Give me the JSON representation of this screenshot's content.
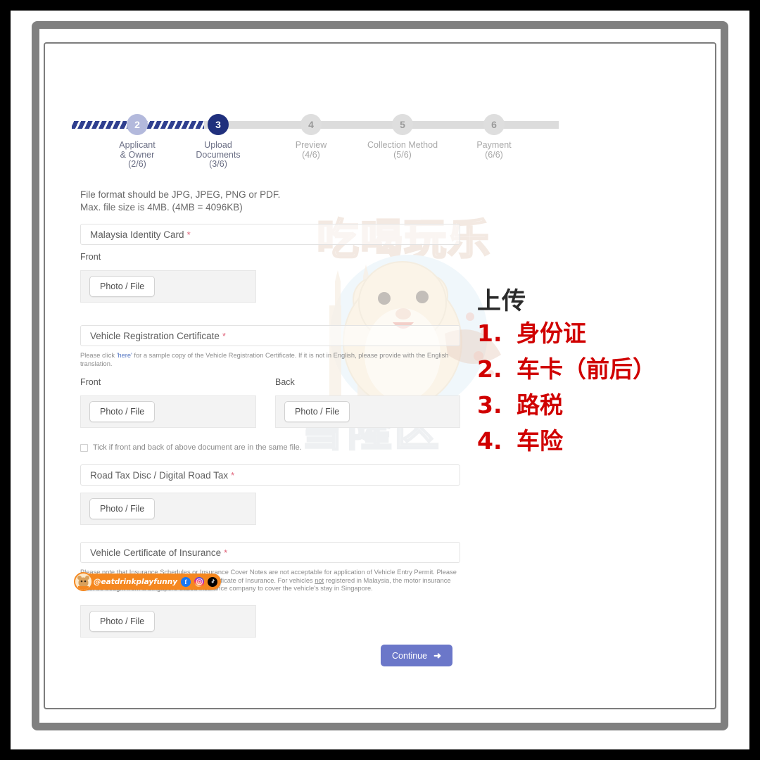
{
  "stepper": {
    "steps": [
      {
        "number": "2",
        "label_line1": "Applicant",
        "label_line2": "& Owner",
        "progress": "(2/6)",
        "state": "completed"
      },
      {
        "number": "3",
        "label_line1": "Upload",
        "label_line2": "Documents",
        "progress": "(3/6)",
        "state": "current"
      },
      {
        "number": "4",
        "label_line1": "Preview",
        "label_line2": "",
        "progress": "(4/6)",
        "state": "upcoming"
      },
      {
        "number": "5",
        "label_line1": "Collection Method",
        "label_line2": "",
        "progress": "(5/6)",
        "state": "upcoming"
      },
      {
        "number": "6",
        "label_line1": "Payment",
        "label_line2": "",
        "progress": "(6/6)",
        "state": "upcoming"
      }
    ],
    "colors": {
      "completed_bar": "#2f3f8f",
      "completed_dot": "#b3b9dc",
      "current_dot": "#20307d",
      "upcoming": "#dedede"
    }
  },
  "format_note": {
    "line1": "File format should be JPG, JPEG, PNG or PDF.",
    "line2": "Max. file size is 4MB. (4MB = 4096KB)"
  },
  "sections": {
    "identity": {
      "title": "Malaysia Identity Card",
      "required_mark": "*",
      "front_caption": "Front",
      "upload_button": "Photo / File"
    },
    "registration": {
      "title": "Vehicle Registration Certificate",
      "required_mark": "*",
      "helper_pre": "Please click ",
      "helper_link": "'here'",
      "helper_post": " for a sample copy of the Vehicle Registration Certificate. If it is not in English, please provide with the English translation.",
      "front_caption": "Front",
      "back_caption": "Back",
      "upload_button": "Photo / File",
      "tick_label": "Tick if front and back of above document are in the same file.",
      "tick_checked": false
    },
    "road_tax": {
      "title": "Road Tax Disc / Digital Road Tax",
      "required_mark": "*",
      "upload_button": "Photo / File"
    },
    "insurance": {
      "title": "Vehicle Certificate of Insurance",
      "required_mark": "*",
      "helper_line1": "Please note that Insurance Schedules or Insurance Cover Notes are not acceptable for application of Vehicle Entry Permit.",
      "helper_line2_pre": "Please click ",
      "helper_link": "'here'",
      "helper_line2_mid": " for a sample copy of the Vehicle Certificate of Insurance. For vehicles ",
      "helper_line2_not": "not",
      "helper_line2_post": " registered in Malaysia, the",
      "helper_line3": "motor insurance must be bought from a Singapore-based insurance company to cover the vehicle's stay in Singapore.",
      "upload_button": "Photo / File"
    }
  },
  "continue_button": {
    "label": "Continue",
    "arrow": "➜",
    "color": "#6b77c9"
  },
  "watermark": {
    "top_text": "吃喝玩乐",
    "bottom_text": "雪隆区"
  },
  "social_badge": {
    "handle": "@eatdrinkplayfunny",
    "icons": [
      "facebook-icon",
      "instagram-icon",
      "tiktok-icon"
    ],
    "facebook_glyph": "f",
    "background": "#f5871f"
  },
  "annotation": {
    "title": "上传",
    "title_color": "#2a2a2a",
    "item_color": "#d00000",
    "items": [
      {
        "number": "1.",
        "text": "身份证"
      },
      {
        "number": "2.",
        "text": "车卡（前后）"
      },
      {
        "number": "3.",
        "text": "路税"
      },
      {
        "number": "4.",
        "text": "车险"
      }
    ]
  }
}
